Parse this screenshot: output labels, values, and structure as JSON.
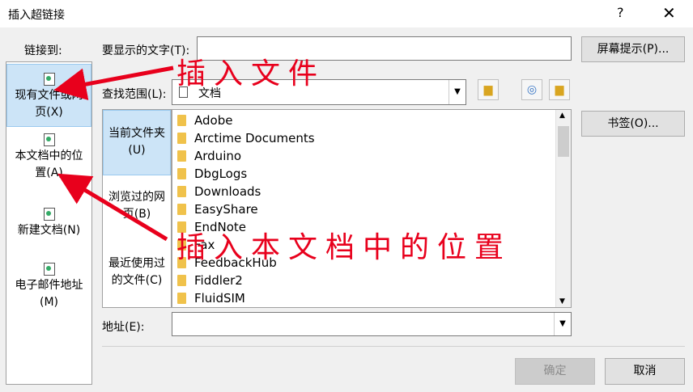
{
  "dialog": {
    "title": "插入超链接",
    "help": "?",
    "close": "✕"
  },
  "link_to": {
    "label": "链接到:",
    "items": [
      {
        "label_a": "现有文件或网",
        "label_b": "页(X)",
        "selected": true
      },
      {
        "label_a": "本文档中的位",
        "label_b": "置(A)",
        "selected": false
      },
      {
        "label_a": "新建文档(N)",
        "label_b": "",
        "selected": false
      },
      {
        "label_a": "电子邮件地址",
        "label_b": "(M)",
        "selected": false
      }
    ]
  },
  "display_text": {
    "label": "要显示的文字(T):",
    "value": ""
  },
  "screentip_button": "屏幕提示(P)...",
  "look_in": {
    "label": "查找范围(L):",
    "value": "文档"
  },
  "nav": {
    "items": [
      {
        "label_a": "当前文件夹",
        "label_b": "(U)",
        "selected": true
      },
      {
        "label_a": "浏览过的网",
        "label_b": "页(B)",
        "selected": false
      },
      {
        "label_a": "最近使用过",
        "label_b": "的文件(C)",
        "selected": false
      }
    ]
  },
  "files": [
    "Adobe",
    "Arctime Documents",
    "Arduino",
    "DbgLogs",
    "Downloads",
    "EasyShare",
    "EndNote",
    "Fax",
    "FeedbackHub",
    "Fiddler2",
    "FluidSIM"
  ],
  "bookmark_button": "书签(O)...",
  "address": {
    "label": "地址(E):",
    "value": ""
  },
  "ok_button": "确定",
  "cancel_button": "取消",
  "annotations": {
    "insert_file": "插入文件",
    "insert_in_doc": "插入本文档中的位置"
  },
  "colors": {
    "annotation": "#e8001c",
    "selection": "#cce4f7"
  }
}
